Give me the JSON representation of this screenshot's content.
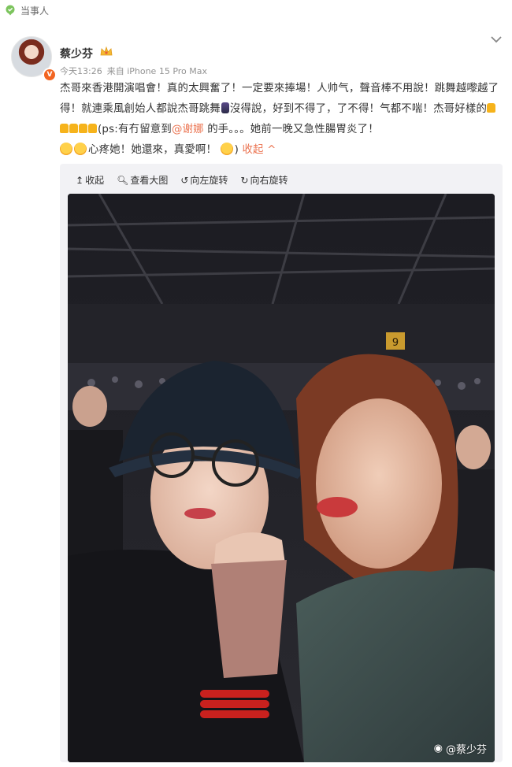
{
  "topic_tag": {
    "label": "当事人",
    "icon": "location-pin-icon",
    "color": "#7cc45d"
  },
  "post": {
    "username": "蔡少芬",
    "badge_icon": "crown-icon",
    "time": "今天13:26",
    "source": "来自 iPhone 15 Pro Max",
    "text_part1": "杰哥來香港開演唱會！真的太興奮了！一定要來捧場！人帅气，聲音棒不用說！跳舞越嚟越了得！就連乘風創始人都說杰哥跳舞",
    "text_part2": "沒得說，好到不得了，了不得！气都不喘！杰哥好樣的",
    "text_part3": "(ps:有冇留意到",
    "mention": "@谢娜",
    "text_part4": " 的手。。。她前一晚又急性腸胃炎了！",
    "text_part5": "心疼她！她還來，真愛啊！",
    "text_part6": ") ",
    "collapse_label": "收起",
    "accent_color": "#eb7350"
  },
  "media_toolbar": {
    "collapse": "收起",
    "view_large": "查看大图",
    "rotate_left": "向左旋转",
    "rotate_right": "向右旋转"
  },
  "photo": {
    "watermark": "@蔡少芬",
    "section_number": "9"
  }
}
